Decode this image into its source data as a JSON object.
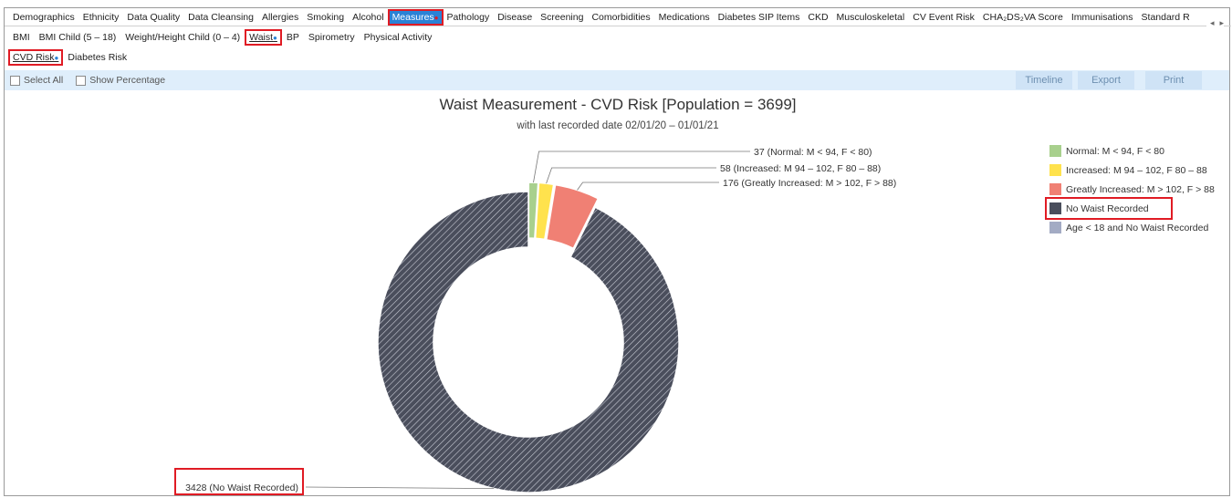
{
  "main_tabs": [
    "Demographics",
    "Ethnicity",
    "Data Quality",
    "Data Cleansing",
    "Allergies",
    "Smoking",
    "Alcohol",
    "Measures",
    "Pathology",
    "Disease",
    "Screening",
    "Comorbidities",
    "Medications",
    "Diabetes SIP Items",
    "CKD",
    "Musculoskeletal",
    "CV Event Risk",
    "CHA₂DS₂VA Score",
    "Immunisations",
    "Standard R"
  ],
  "active_main_tab": "Measures",
  "sub_tabs": [
    "BMI",
    "BMI Child (5 – 18)",
    "Weight/Height Child (0 – 4)",
    "Waist",
    "BP",
    "Spirometry",
    "Physical Activity"
  ],
  "active_sub_tab": "Waist",
  "sub_sub_tabs": [
    "CVD Risk",
    "Diabetes Risk"
  ],
  "active_sub_sub_tab": "CVD Risk",
  "toolbar": {
    "select_all": "Select All",
    "show_percentage": "Show Percentage",
    "timeline": "Timeline",
    "export": "Export",
    "print": "Print"
  },
  "icons": {
    "scroll_left": "◂",
    "scroll_right": "▸",
    "dot": "●"
  },
  "chart_data": {
    "type": "pie",
    "title": "Waist Measurement - CVD Risk [Population = 3699]",
    "subtitle": "with last recorded date 02/01/20 – 01/01/21",
    "slices": [
      {
        "label": "Normal: M < 94, F < 80",
        "value": 37,
        "data_label": "37 (Normal: M < 94, F < 80)",
        "color": "#a8d08d"
      },
      {
        "label": "Increased: M 94 – 102, F 80 – 88",
        "value": 58,
        "data_label": "58 (Increased: M 94 – 102, F 80 – 88)",
        "color": "#ffe24d"
      },
      {
        "label": "Greatly Increased: M > 102, F > 88",
        "value": 176,
        "data_label": "176 (Greatly Increased: M > 102, F > 88)",
        "color": "#f08074"
      },
      {
        "label": "No Waist Recorded",
        "value": 3428,
        "data_label": "3428 (No Waist Recorded)",
        "color": "#4a4e5c"
      }
    ],
    "legend": [
      {
        "label": "Normal: M < 94, F < 80",
        "color": "#a8d08d"
      },
      {
        "label": "Increased: M 94 – 102, F 80 – 88",
        "color": "#ffe24d"
      },
      {
        "label": "Greatly Increased: M > 102, F > 88",
        "color": "#f08074"
      },
      {
        "label": "No Waist Recorded",
        "color": "#4a4e5c"
      },
      {
        "label": "Age < 18 and No Waist Recorded",
        "color": "#a3abc4"
      }
    ],
    "legend_position": "right"
  }
}
